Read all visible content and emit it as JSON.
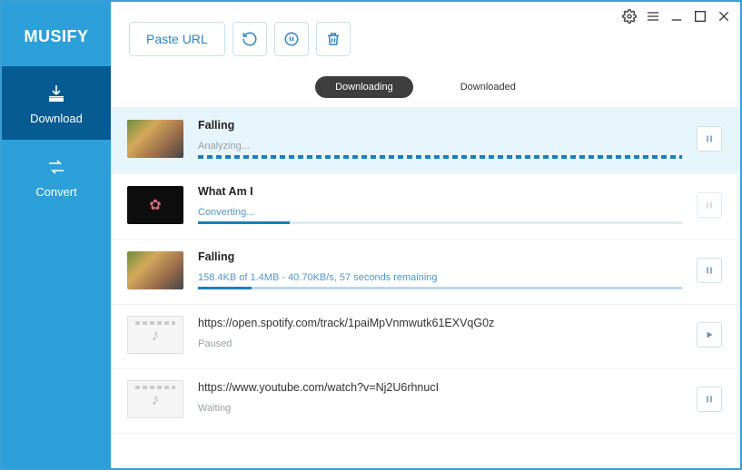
{
  "app": {
    "name": "MUSIFY"
  },
  "nav": {
    "download": "Download",
    "convert": "Convert"
  },
  "toolbar": {
    "paste": "Paste URL"
  },
  "tabs": {
    "downloading": "Downloading",
    "downloaded": "Downloaded"
  },
  "items": [
    {
      "title": "Falling",
      "status": "Analyzing..."
    },
    {
      "title": "What Am I",
      "status": "Converting..."
    },
    {
      "title": "Falling",
      "status": "158.4KB of 1.4MB - 40.70KB/s, 57 seconds remaining"
    },
    {
      "title": "https://open.spotify.com/track/1paiMpVnmwutk61EXVqG0z",
      "status": "Paused"
    },
    {
      "title": "https://www.youtube.com/watch?v=Nj2U6rhnucI",
      "status": "Waiting"
    }
  ]
}
